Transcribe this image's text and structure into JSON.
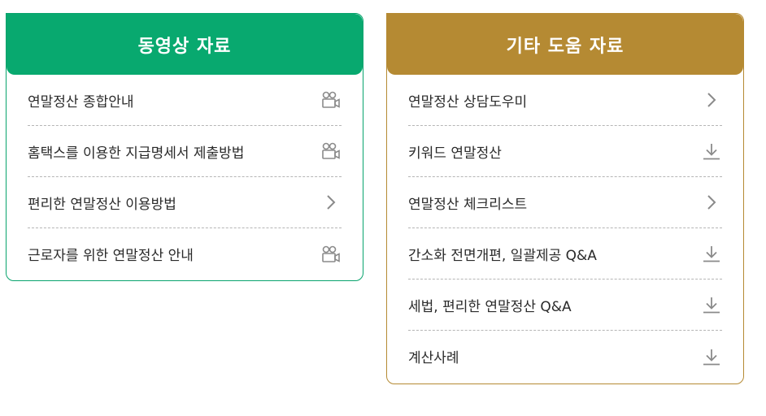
{
  "video_panel": {
    "title": "동영상 자료",
    "items": [
      {
        "label": "연말정산 종합안내",
        "icon": "video-camera-icon"
      },
      {
        "label": "홈택스를 이용한 지급명세서 제출방법",
        "icon": "video-camera-icon"
      },
      {
        "label": "편리한 연말정산 이용방법",
        "icon": "chevron-right-icon"
      },
      {
        "label": "근로자를 위한 연말정산 안내",
        "icon": "video-camera-icon"
      }
    ]
  },
  "help_panel": {
    "title": "기타 도움 자료",
    "items": [
      {
        "label": "연말정산 상담도우미",
        "icon": "chevron-right-icon"
      },
      {
        "label": "키워드 연말정산",
        "icon": "download-icon"
      },
      {
        "label": "연말정산 체크리스트",
        "icon": "chevron-right-icon"
      },
      {
        "label": "간소화 전면개편, 일괄제공 Q&A",
        "icon": "download-icon"
      },
      {
        "label": "세법, 편리한 연말정산 Q&A",
        "icon": "download-icon"
      },
      {
        "label": "계산사례",
        "icon": "download-icon"
      }
    ]
  },
  "colors": {
    "video_accent": "#08a96f",
    "help_accent": "#b58a33",
    "icon_gray": "#8a8a8a"
  }
}
